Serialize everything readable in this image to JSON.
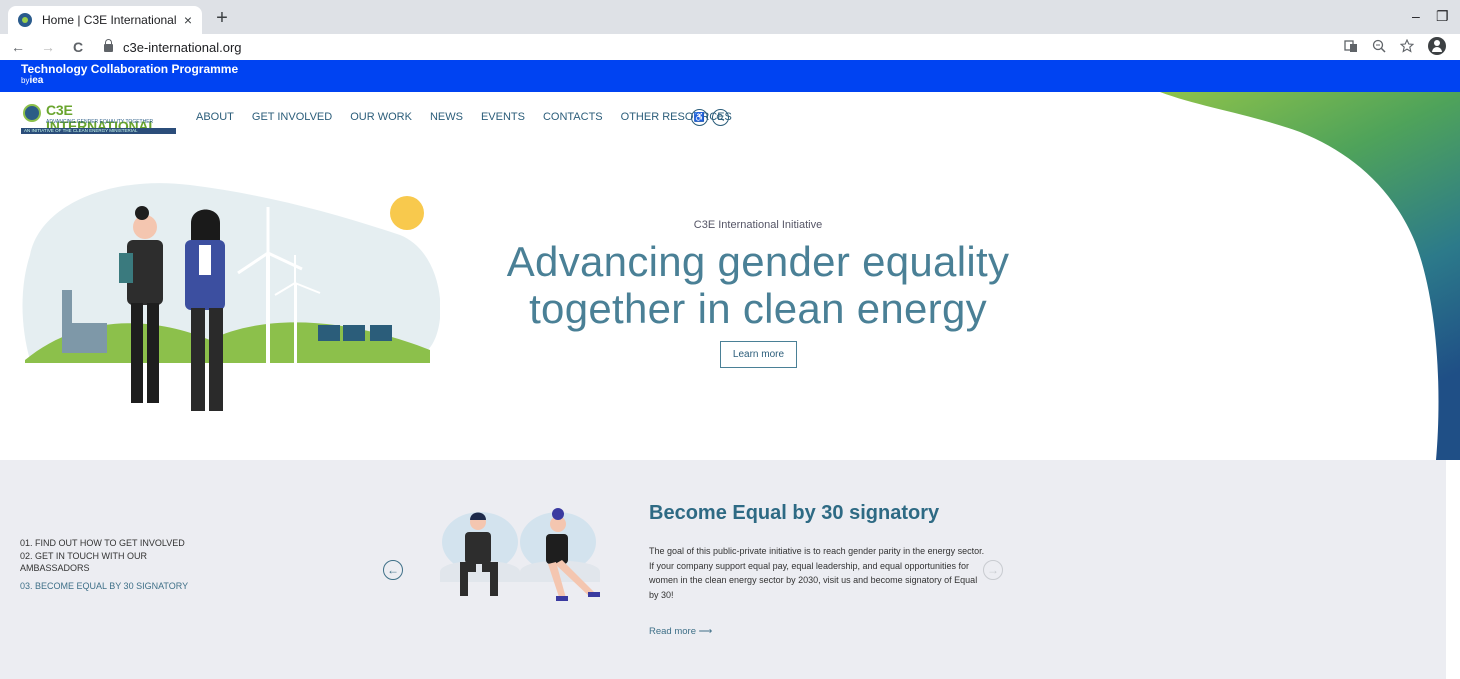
{
  "browser": {
    "tab_title": "Home | C3E International",
    "tab_close": "×",
    "new_tab": "+",
    "url": "c3e-international.org",
    "back": "←",
    "forward": "→",
    "reload": "C",
    "minimize": "–",
    "restore": "❐"
  },
  "site": {
    "tcp_title": "Technology Collaboration Programme",
    "tcp_by": "by",
    "tcp_brand": "iea",
    "logo_name": "C3E INTERNATIONAL",
    "logo_tagline": "ADVANCING GENDER EQUALITY TOGETHER",
    "logo_strip": "AN INITIATIVE OF THE CLEAN ENERGY MINISTERIAL",
    "nav": [
      "ABOUT",
      "GET INVOLVED",
      "OUR WORK",
      "NEWS",
      "EVENTS",
      "CONTACTS",
      "OTHER RESOURCES"
    ]
  },
  "hero": {
    "kicker": "C3E International Initiative",
    "title_line1": "Advancing gender equality",
    "title_line2": "together in clean energy",
    "button": "Learn more"
  },
  "carousel": {
    "steps": [
      {
        "num": "01.",
        "label": "FIND OUT HOW TO GET INVOLVED"
      },
      {
        "num": "02.",
        "label": "GET IN TOUCH WITH OUR AMBASSADORS"
      },
      {
        "num": "03.",
        "label": "BECOME EQUAL BY 30 SIGNATORY"
      }
    ],
    "title": "Become Equal by 30 signatory",
    "body": "The goal of this public-private initiative is to reach gender parity in the energy sector. If your company support equal pay, equal leadership, and equal opportunities for women in the clean energy sector by 2030, visit us and become signatory of Equal by 30!",
    "read_more": "Read more ⟶",
    "prev": "←",
    "next": "→"
  },
  "colors": {
    "tcp_bar": "#0043f2",
    "accent": "#4a8096",
    "carousel_bg": "#ecedf2"
  }
}
